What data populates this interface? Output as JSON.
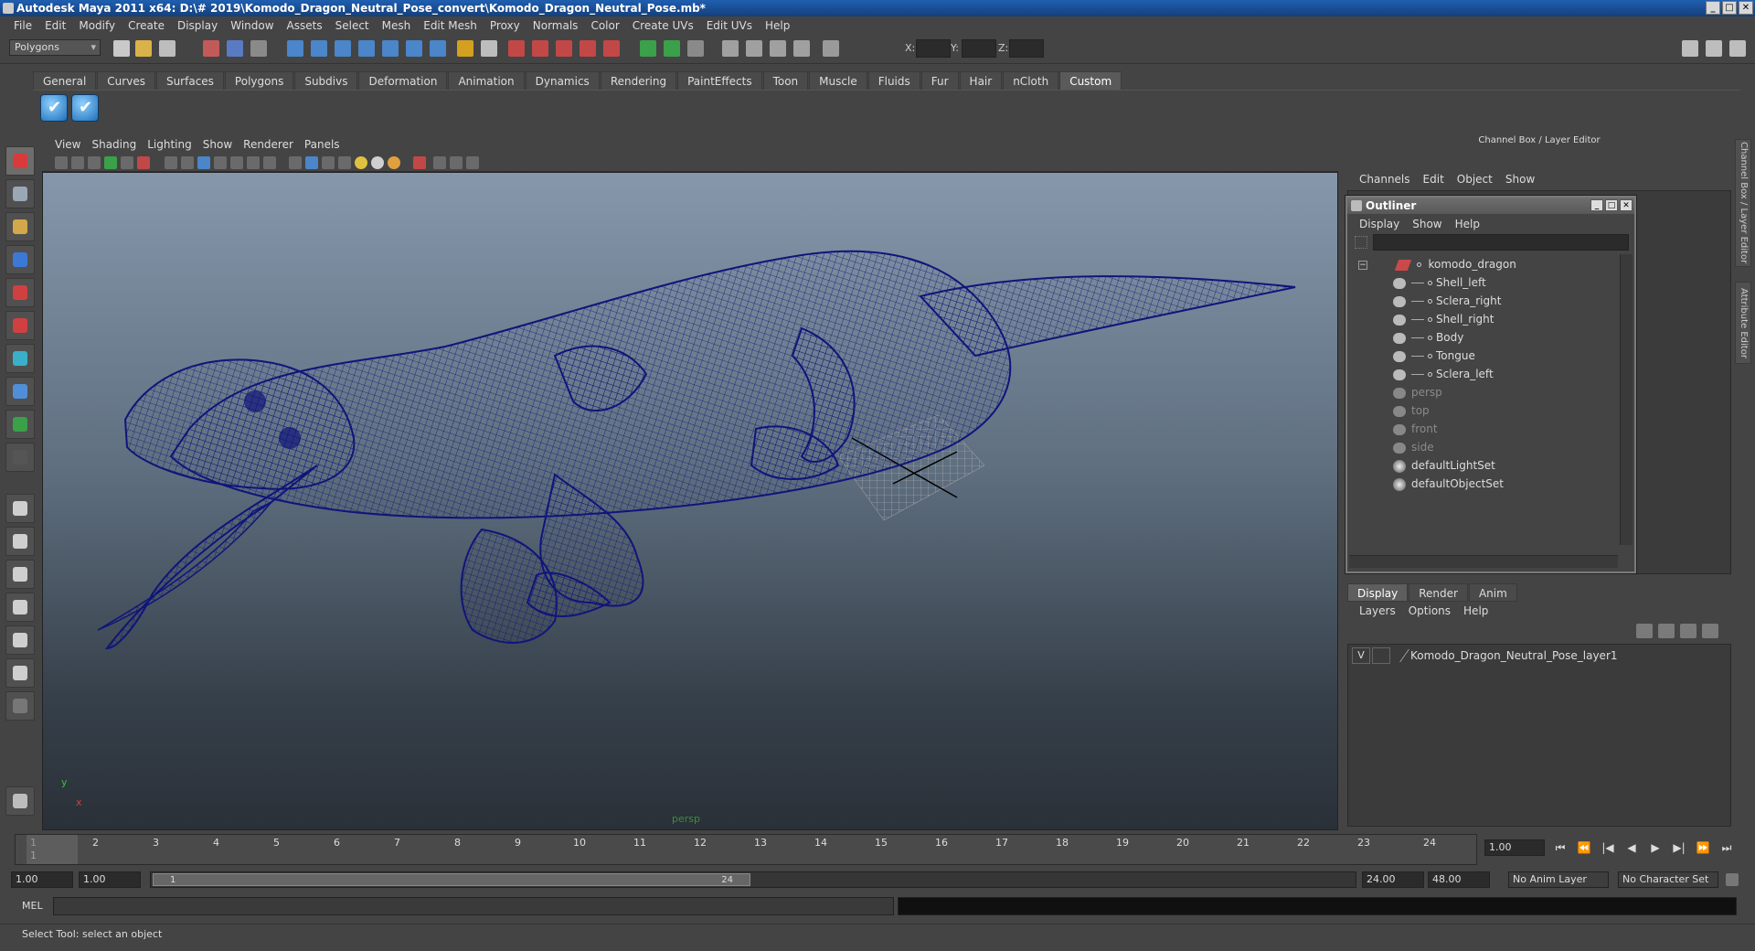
{
  "window": {
    "title": "Autodesk Maya 2011 x64: D:\\# 2019\\Komodo_Dragon_Neutral_Pose_convert\\Komodo_Dragon_Neutral_Pose.mb*",
    "min": "_",
    "max": "□",
    "close": "✕"
  },
  "menubar": [
    "File",
    "Edit",
    "Modify",
    "Create",
    "Display",
    "Window",
    "Assets",
    "Select",
    "Mesh",
    "Edit Mesh",
    "Proxy",
    "Normals",
    "Color",
    "Create UVs",
    "Edit UVs",
    "Help"
  ],
  "status": {
    "mode": "Polygons",
    "x_label": "X:",
    "y_label": "Y:",
    "z_label": "Z:"
  },
  "shelf": {
    "tabs": [
      "General",
      "Curves",
      "Surfaces",
      "Polygons",
      "Subdivs",
      "Deformation",
      "Animation",
      "Dynamics",
      "Rendering",
      "PaintEffects",
      "Toon",
      "Muscle",
      "Fluids",
      "Fur",
      "Hair",
      "nCloth",
      "Custom"
    ],
    "active": "Custom"
  },
  "viewport": {
    "menu": [
      "View",
      "Shading",
      "Lighting",
      "Show",
      "Renderer",
      "Panels"
    ],
    "camera": "persp",
    "axis_y": "y",
    "axis_x": "x",
    "wire_color": "#10157a"
  },
  "channelbox": {
    "title": "Channel Box / Layer Editor",
    "menu": [
      "Channels",
      "Edit",
      "Object",
      "Show"
    ]
  },
  "outliner": {
    "title": "Outliner",
    "menu": [
      "Display",
      "Show",
      "Help"
    ],
    "root": "komodo_dragon",
    "children": [
      "Shell_left",
      "Sclera_right",
      "Shell_right",
      "Body",
      "Tongue",
      "Sclera_left"
    ],
    "cameras": [
      "persp",
      "top",
      "front",
      "side"
    ],
    "sets": [
      "defaultLightSet",
      "defaultObjectSet"
    ]
  },
  "layers": {
    "tabs": [
      "Display",
      "Render",
      "Anim"
    ],
    "active": "Display",
    "menu": [
      "Layers",
      "Options",
      "Help"
    ],
    "row_visibility": "V",
    "row_name": "Komodo_Dragon_Neutral_Pose_layer1"
  },
  "vertical_tabs": [
    "Channel Box / Layer Editor",
    "Attribute Editor"
  ],
  "timeline": {
    "ticks": [
      "1",
      "2",
      "3",
      "4",
      "5",
      "6",
      "7",
      "8",
      "9",
      "10",
      "11",
      "12",
      "13",
      "14",
      "15",
      "16",
      "17",
      "18",
      "19",
      "20",
      "21",
      "22",
      "23",
      "24"
    ],
    "current_marker": "1",
    "current_frame": "1.00",
    "play_buttons": [
      "⏮",
      "⏪",
      "|◀",
      "◀",
      "▶",
      "▶|",
      "⏩",
      "⏭"
    ]
  },
  "range": {
    "start": "1.00",
    "playback_start": "1.00",
    "thumb_start": "1",
    "thumb_end": "24",
    "playback_end": "24.00",
    "end": "48.00",
    "anim_layer": "No Anim Layer",
    "character_set": "No Character Set"
  },
  "commandline": {
    "label": "MEL"
  },
  "helpline": {
    "text": "Select Tool: select an object"
  }
}
